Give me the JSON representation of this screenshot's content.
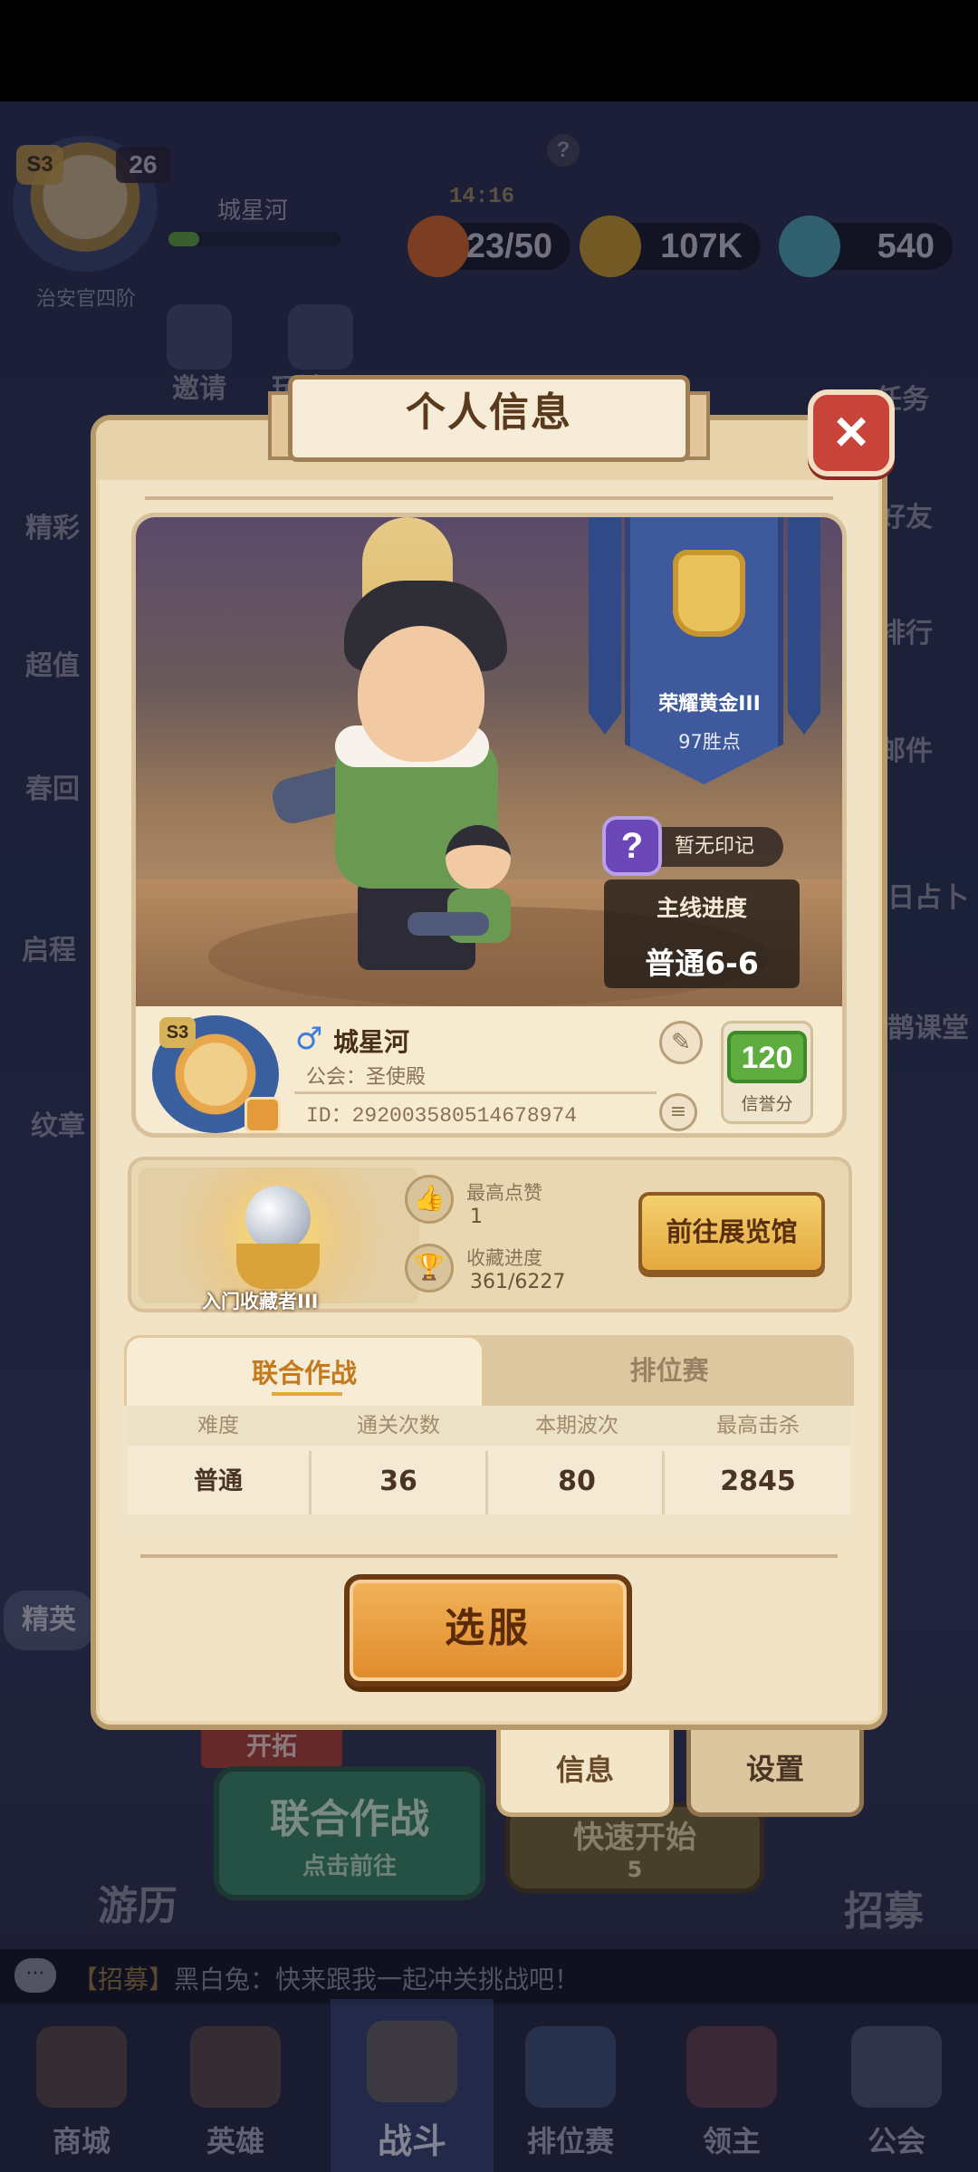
{
  "hud": {
    "season": "S3",
    "level": "26",
    "player_name": "城星河",
    "rank_title": "治安官四阶",
    "timer": "14:16",
    "stamina": "23/50",
    "gold": "107K",
    "gems": "540",
    "help": "?"
  },
  "side_left": [
    "邀请",
    "玩法入口",
    "精彩",
    "超值",
    "春回",
    "启程",
    "纹章",
    "精英"
  ],
  "side_right": [
    "任务",
    "好友",
    "排行",
    "邮件",
    "每日占卜",
    "小鹊课堂"
  ],
  "background_buttons": {
    "expedition_label": "开拓",
    "coop_main": "联合作战",
    "coop_sub": "点击前往",
    "quick_start": "快速开始",
    "quick_count": "5",
    "travel": "游历",
    "recruit": "招募"
  },
  "chat": {
    "icon": "···",
    "tag": "【招募】",
    "message": "黑白兔：快来跟我一起冲关挑战吧！"
  },
  "bottom_nav": {
    "items": [
      {
        "label": "商城"
      },
      {
        "label": "英雄"
      },
      {
        "label": "战斗"
      },
      {
        "label": "排位赛"
      },
      {
        "label": "领主"
      },
      {
        "label": "公会"
      }
    ],
    "active_index": 2
  },
  "modal": {
    "title": "个人信息",
    "close": "×",
    "rank": {
      "name": "荣耀黄金III",
      "points": "97胜点"
    },
    "mark": {
      "icon": "?",
      "text": "暂无印记"
    },
    "progress": {
      "title": "主线进度",
      "value": "普通6-6"
    },
    "profile": {
      "season": "S3",
      "gender": "♂",
      "name": "城星河",
      "guild": "公会：圣使殿",
      "id": "ID：292003580514678974",
      "credit_value": "120",
      "credit_label": "信誉分"
    },
    "collection": {
      "title": "入门收藏者III",
      "likes_label": "最高点赞",
      "likes_value": "1",
      "collect_label": "收藏进度",
      "collect_value": "361/6227",
      "museum_button": "前往展览馆"
    },
    "tabs": [
      {
        "label": "联合作战"
      },
      {
        "label": "排位赛"
      }
    ],
    "table": {
      "headers": [
        "难度",
        "通关次数",
        "本期波次",
        "最高击杀"
      ],
      "row": [
        "普通",
        "36",
        "80",
        "2845"
      ]
    },
    "select_server": "选服",
    "footer_tabs": [
      {
        "label": "信息"
      },
      {
        "label": "设置"
      }
    ]
  },
  "colors": {
    "accent": "#e08a2a",
    "tab_active_text": "#c47a1c",
    "close_red": "#c8443a",
    "credit_green": "#5fad3e",
    "banner_blue": "#3f5a9c"
  }
}
